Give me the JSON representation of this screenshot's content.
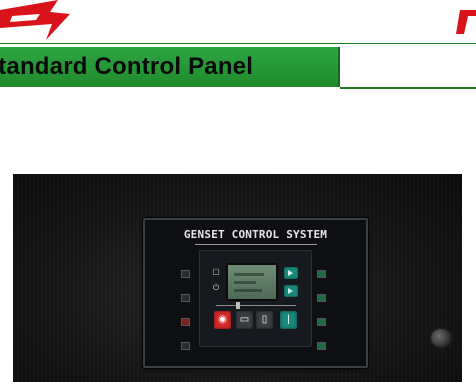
{
  "header": {
    "title": "Standard Control Panel"
  },
  "panel": {
    "title": "GENSET CONTROL SYSTEM"
  },
  "colors": {
    "logo_red": "#d8131b",
    "title_bar_green": "#27a038",
    "panel_dark": "#0d0f12",
    "stop_button": "#d42a2a",
    "nav_button": "#1a8a7d"
  },
  "icons": {
    "menu": "page-icon",
    "power": "power-icon",
    "stop": "stop-icon",
    "auto": "auto-icon",
    "manual": "manual-icon",
    "start": "start-icon",
    "next": "arrow-right-icon"
  }
}
